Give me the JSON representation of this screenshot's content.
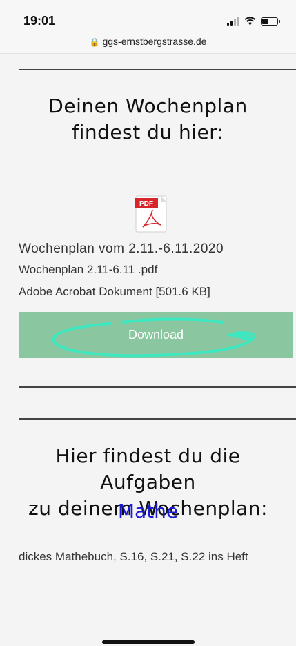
{
  "status_bar": {
    "time": "19:01",
    "url": "ggs-ernstbergstrasse.de",
    "battery_level": 0.45
  },
  "section1": {
    "heading": [
      "Deinen Wochenplan",
      "findest du hier:"
    ]
  },
  "file": {
    "icon_label": "PDF",
    "title": "Wochenplan vom 2.11.-6.11.2020",
    "name": "Wochenplan 2.11-6.11 .pdf",
    "description": "Adobe Acrobat Dokument [501.6 KB]",
    "download_label": "Download"
  },
  "section2": {
    "heading": [
      "Hier findest du die",
      "Aufgaben",
      "zu deinem Wochenplan:"
    ],
    "subject": "Mathe",
    "task": "dickes Mathebuch, S.16, S.21, S.22  ins Heft"
  },
  "colors": {
    "download_button": "#8ac7a1",
    "scribble": "#3de8c0",
    "subject": "#1a1ad6"
  }
}
